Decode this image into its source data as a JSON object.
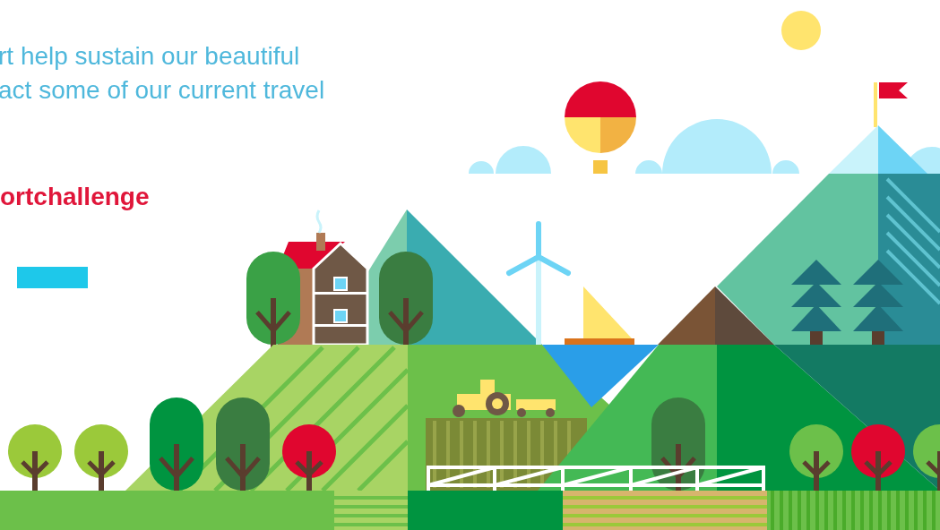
{
  "intro": {
    "lines": [
      "rt help sustain our beautiful",
      "act some of our current travel"
    ]
  },
  "heading": "ortchallenge",
  "action_button": {
    "kind": "blank"
  }
}
